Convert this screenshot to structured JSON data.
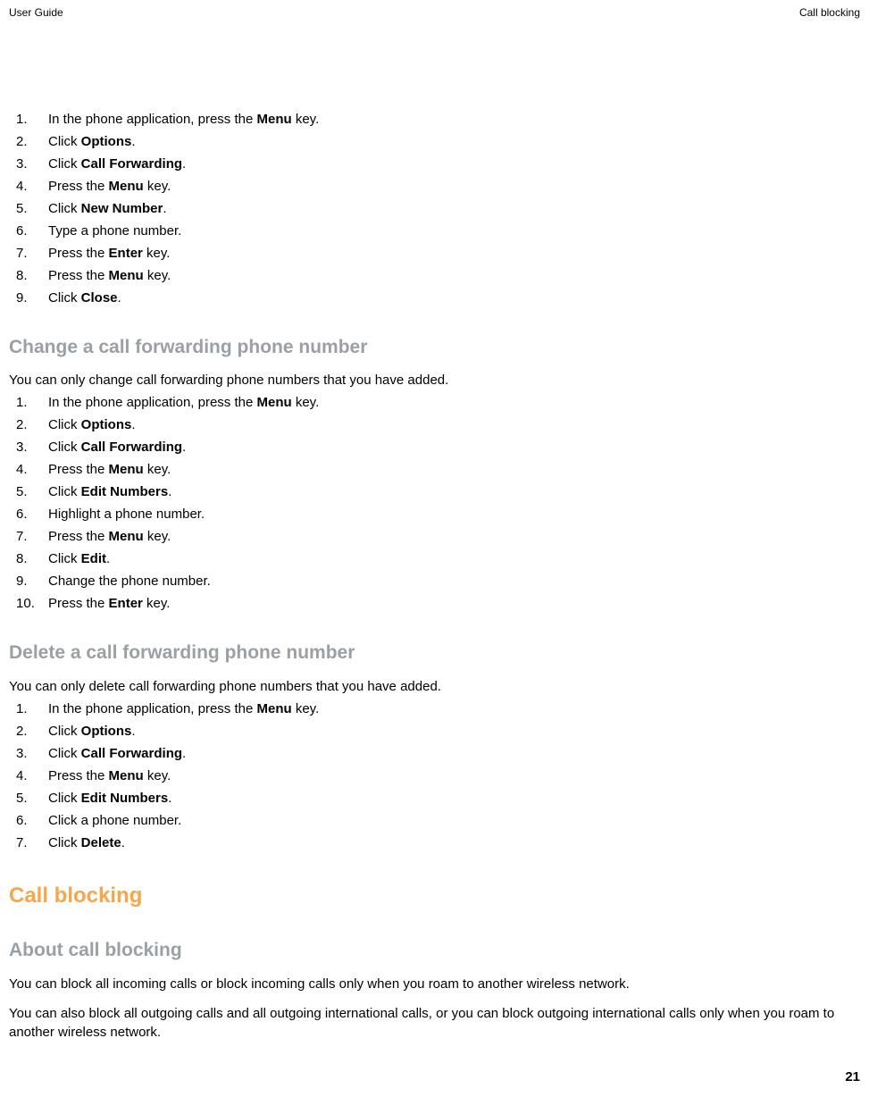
{
  "header": {
    "left": "User Guide",
    "right": "Call blocking"
  },
  "section1": {
    "items": [
      {
        "pre": "In the phone application, press the ",
        "bold": "Menu",
        "post": " key."
      },
      {
        "pre": "Click ",
        "bold": "Options",
        "post": "."
      },
      {
        "pre": "Click ",
        "bold": "Call Forwarding",
        "post": "."
      },
      {
        "pre": "Press the ",
        "bold": "Menu",
        "post": " key."
      },
      {
        "pre": "Click ",
        "bold": "New Number",
        "post": "."
      },
      {
        "pre": "Type a phone number.",
        "bold": "",
        "post": ""
      },
      {
        "pre": "Press the ",
        "bold": "Enter",
        "post": " key."
      },
      {
        "pre": "Press the ",
        "bold": "Menu",
        "post": " key."
      },
      {
        "pre": "Click ",
        "bold": "Close",
        "post": "."
      }
    ]
  },
  "section2": {
    "heading": "Change a call forwarding phone number",
    "intro": "You can only change call forwarding phone numbers that you have added.",
    "items": [
      {
        "pre": "In the phone application, press the ",
        "bold": "Menu",
        "post": " key."
      },
      {
        "pre": "Click ",
        "bold": "Options",
        "post": "."
      },
      {
        "pre": "Click ",
        "bold": "Call Forwarding",
        "post": "."
      },
      {
        "pre": "Press the ",
        "bold": "Menu",
        "post": " key."
      },
      {
        "pre": "Click ",
        "bold": "Edit Numbers",
        "post": "."
      },
      {
        "pre": "Highlight a phone number.",
        "bold": "",
        "post": ""
      },
      {
        "pre": "Press the ",
        "bold": "Menu",
        "post": " key."
      },
      {
        "pre": "Click ",
        "bold": "Edit",
        "post": "."
      },
      {
        "pre": "Change the phone number.",
        "bold": "",
        "post": ""
      },
      {
        "pre": "Press the ",
        "bold": "Enter",
        "post": " key."
      }
    ]
  },
  "section3": {
    "heading": "Delete a call forwarding phone number",
    "intro": "You can only delete call forwarding phone numbers that you have added.",
    "items": [
      {
        "pre": "In the phone application, press the ",
        "bold": "Menu",
        "post": " key."
      },
      {
        "pre": "Click ",
        "bold": "Options",
        "post": "."
      },
      {
        "pre": "Click ",
        "bold": "Call Forwarding",
        "post": "."
      },
      {
        "pre": "Press the ",
        "bold": "Menu",
        "post": " key."
      },
      {
        "pre": "Click ",
        "bold": "Edit Numbers",
        "post": "."
      },
      {
        "pre": "Click a phone number.",
        "bold": "",
        "post": ""
      },
      {
        "pre": "Click ",
        "bold": "Delete",
        "post": "."
      }
    ]
  },
  "section4": {
    "heading_main": "Call blocking",
    "heading_sub": "About call blocking",
    "para1": "You can block all incoming calls or block incoming calls only when you roam to another wireless network.",
    "para2": "You can also block all outgoing calls and all outgoing international calls, or you can block outgoing international calls only when you roam to another wireless network."
  },
  "page_number": "21"
}
